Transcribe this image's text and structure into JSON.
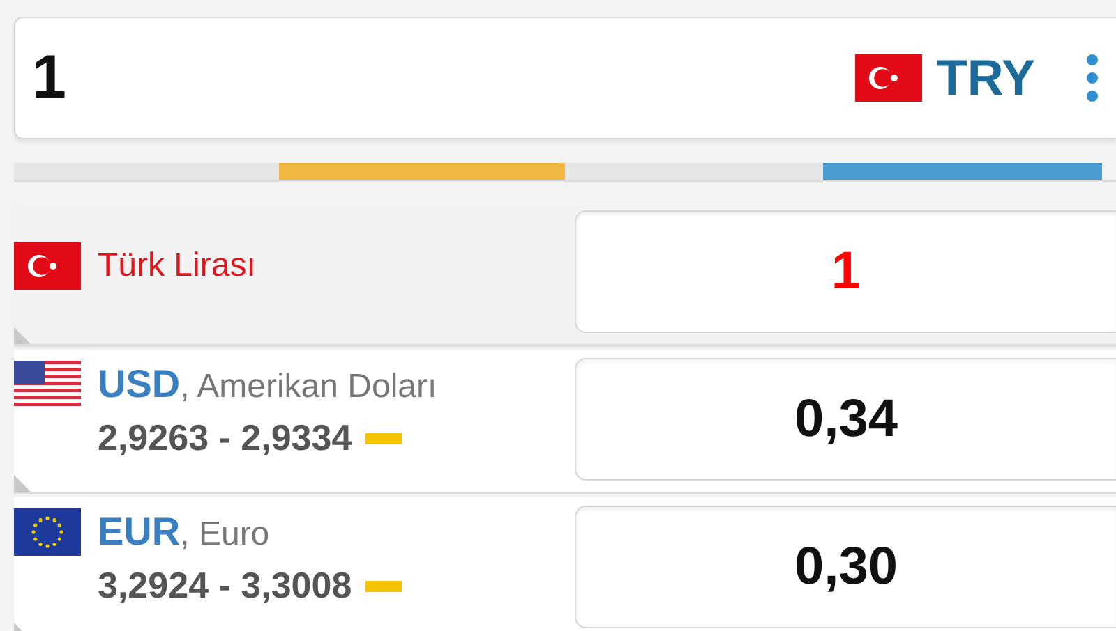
{
  "converter": {
    "amount": "1",
    "flag": {
      "kind": "tr"
    },
    "currency": "TRY"
  },
  "segments": [
    {
      "color": "#e6e6e6"
    },
    {
      "color": "#f0b840"
    },
    {
      "color": "#e6e6e6"
    },
    {
      "color": "#4a9bd0"
    }
  ],
  "rows": [
    {
      "kind": "base",
      "flag": {
        "kind": "tr"
      },
      "title": "Türk Lirası",
      "value": "1",
      "selected": true
    },
    {
      "kind": "rate",
      "flag": {
        "kind": "us"
      },
      "title": "**USD**, Amerikan Doları",
      "rates": "2,9263 - 2,9334",
      "trend": {
        "kind": "flat"
      },
      "value": "0,34",
      "selected": false
    },
    {
      "kind": "rate",
      "flag": {
        "kind": "eu"
      },
      "title": "**EUR**, Euro",
      "rates": "3,2924 - 3,3008",
      "trend": {
        "kind": "flat"
      },
      "value": "0,30",
      "selected": false
    }
  ]
}
